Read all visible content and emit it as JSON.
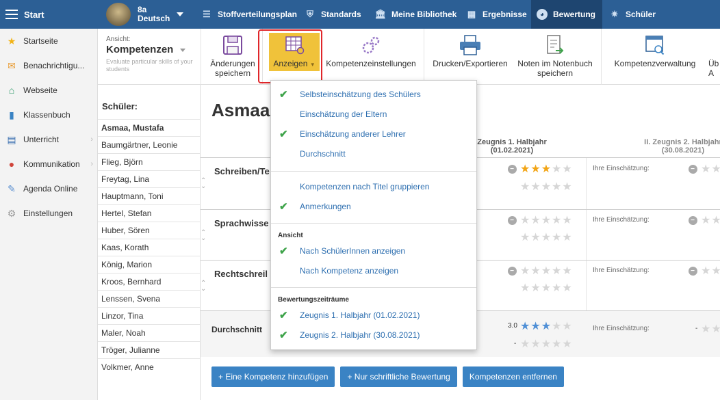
{
  "topbar": {
    "start_label": "Start",
    "class_line1": "8a",
    "class_line2": "Deutsch",
    "nav": [
      {
        "label": "Stoffverteilungsplan",
        "icon": "layers-icon"
      },
      {
        "label": "Standards",
        "icon": "shield-icon"
      },
      {
        "label": "Meine Bibliothek",
        "icon": "library-icon"
      },
      {
        "label": "Ergebnisse",
        "icon": "bar-chart-icon"
      },
      {
        "label": "Bewertung",
        "icon": "gauge-icon"
      },
      {
        "label": "Schüler",
        "icon": "students-icon"
      }
    ]
  },
  "sidebar": {
    "items": [
      {
        "label": "Startseite",
        "icon": "star-icon"
      },
      {
        "label": "Benachrichtigu...",
        "icon": "envelope-icon"
      },
      {
        "label": "Webseite",
        "icon": "home-icon"
      },
      {
        "label": "Klassenbuch",
        "icon": "notebook-icon"
      },
      {
        "label": "Unterricht",
        "icon": "book-icon"
      },
      {
        "label": "Kommunikation",
        "icon": "chat-icon"
      },
      {
        "label": "Agenda Online",
        "icon": "pen-icon"
      },
      {
        "label": "Einstellungen",
        "icon": "gear-icon"
      }
    ]
  },
  "toolbar": {
    "view_label": "Ansicht:",
    "view_value": "Kompetenzen",
    "view_desc": "Evaluate particular skills of your students",
    "save_label": "Änderungen speichern",
    "anzeigen_label": "Anzeigen",
    "komp_settings_label": "Kompetenzeinstellungen",
    "print_label": "Drucken/Exportieren",
    "notes_label": "Noten im Notenbuch speichern",
    "komp_admin_label": "Kompetenzverwaltung",
    "cut_label": "Üb A"
  },
  "students": {
    "header": "Schüler:",
    "list": [
      "Asmaa, Mustafa",
      "Baumgärtner, Leonie",
      "Flieg, Björn",
      "Freytag, Lina",
      "Hauptmann, Toni",
      "Hertel, Stefan",
      "Huber, Sören",
      "Kaas, Korath",
      "König, Marion",
      "Kroos, Bernhard",
      "Lenssen, Svena",
      "Linzor, Tina",
      "Maler, Noah",
      "Tröger, Julianne",
      "Volkmer, Anne"
    ]
  },
  "main": {
    "title": "Asmaa",
    "col1_line1": "Zeugnis 1. Halbjahr",
    "col1_line2": "(01.02.2021)",
    "col2_line1": "II. Zeugnis 2. Halbjahr",
    "col2_line2": "(30.08.2021)",
    "rows": [
      {
        "name": "Schreiben/Te",
        "stars": 3
      },
      {
        "name": "Sprachwisse",
        "stars": 0
      },
      {
        "name": "Rechtschreil",
        "stars": 0
      }
    ],
    "ihre_label": "Ihre Einschätzung:",
    "avg_label": "Durchschnitt",
    "avg_value": "3.0",
    "avg_dash": "-",
    "avg_dash2": "-",
    "buttons": [
      "+ Eine Kompetenz hinzufügen",
      "+ Nur schriftliche Bewertung",
      "Kompetenzen entfernen"
    ]
  },
  "dropdown": {
    "group1": [
      {
        "label": "Selbsteinschätzung des Schülers",
        "checked": true
      },
      {
        "label": "Einschätzung der Eltern",
        "checked": false
      },
      {
        "label": "Einschätzung anderer Lehrer",
        "checked": true
      },
      {
        "label": "Durchschnitt",
        "checked": false
      }
    ],
    "group2": [
      {
        "label": "Kompetenzen nach Titel gruppieren",
        "checked": false
      },
      {
        "label": "Anmerkungen",
        "checked": true
      }
    ],
    "section_view": "Ansicht",
    "group3": [
      {
        "label": "Nach SchülerInnen anzeigen",
        "checked": true
      },
      {
        "label": "Nach Kompetenz anzeigen",
        "checked": false
      }
    ],
    "section_periods": "Bewertungszeiträume",
    "group4": [
      {
        "label": "Zeugnis 1. Halbjahr (01.02.2021)",
        "checked": true
      },
      {
        "label": "Zeugnis 2. Halbjahr (30.08.2021)",
        "checked": true
      }
    ]
  },
  "colors": {
    "topbar": "#2c5f95",
    "active_nav": "#1e4570",
    "accent_button": "#3a83c4",
    "highlight": "#f0c23a",
    "check": "#3ea34a",
    "star": "#f2a516"
  }
}
